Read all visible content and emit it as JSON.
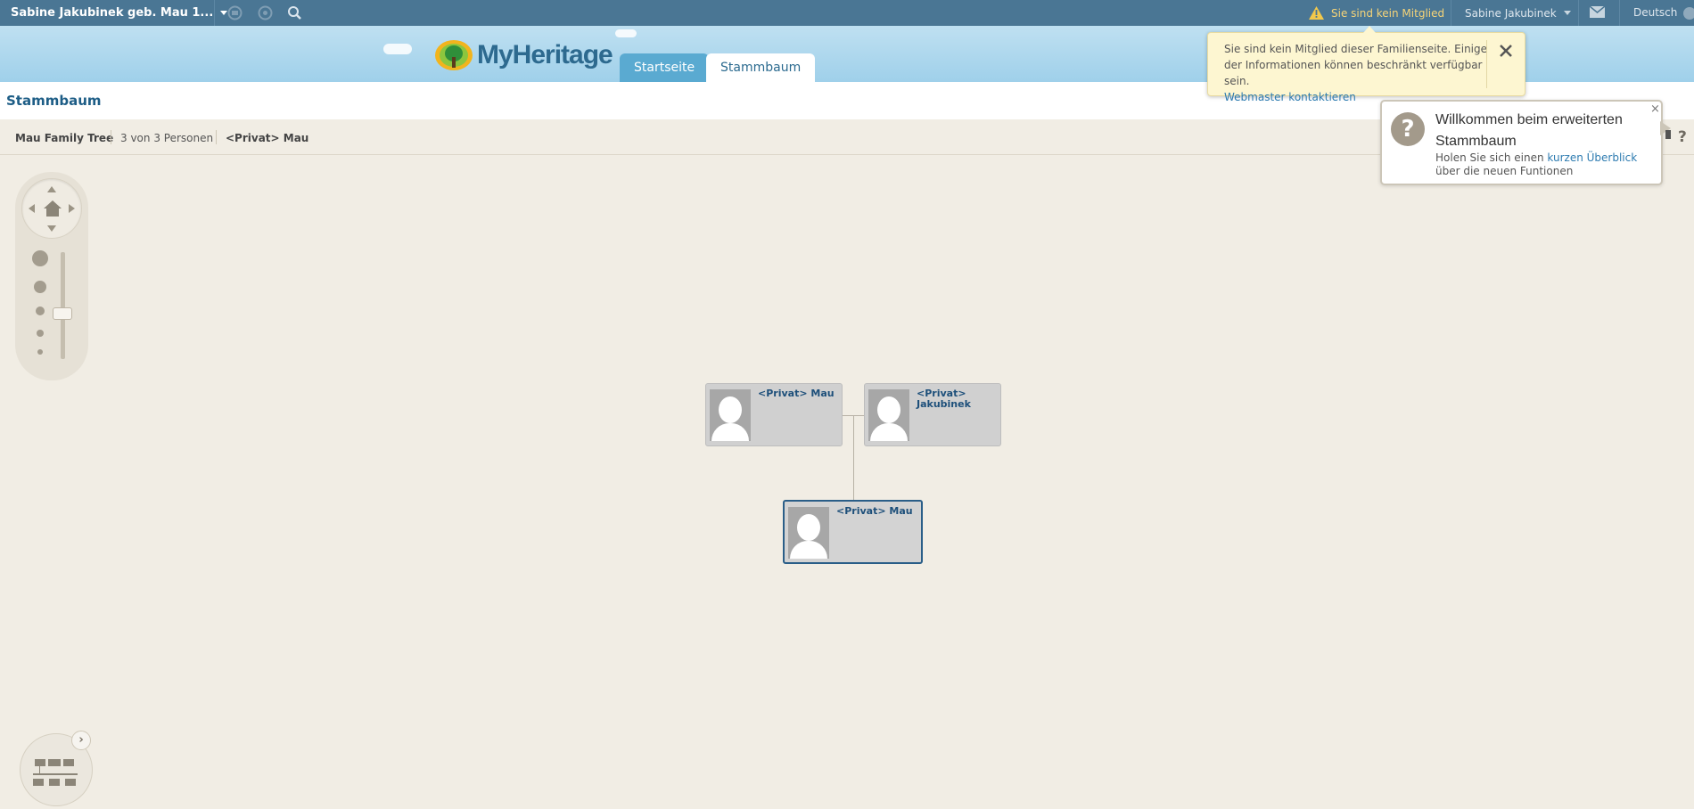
{
  "topbar": {
    "site_name": "Sabine Jakubinek geb. Mau 1...",
    "warning": "Sie sind kein Mitglied",
    "user_name": "Sabine Jakubinek",
    "language": "Deutsch",
    "icons": [
      "caret-down-icon",
      "history-back-icon",
      "history-forward-icon",
      "search-icon",
      "warning-icon",
      "mail-icon",
      "globe-icon"
    ]
  },
  "header": {
    "logo_text": "MyHeritage",
    "tabs": [
      {
        "label": "Startseite"
      },
      {
        "label": "Stammbaum"
      }
    ]
  },
  "page": {
    "title": "Stammbaum"
  },
  "breadcrumb": {
    "tree_name": "Mau Family Tree",
    "count": "3 von 3 Personen",
    "person": "<Privat> Mau"
  },
  "notification": {
    "text": "Sie sind kein Mitglied dieser Familienseite. Einige der Informationen können beschränkt verfügbar sein.",
    "link": "Webmaster kontaktieren"
  },
  "welcome": {
    "title": "Willkommen beim erweiterten Stammbaum",
    "body_prefix": "Holen Sie sich einen",
    "link": "kurzen Überblick",
    "body_suffix": "über die neuen Funtionen",
    "close": "×"
  },
  "tree": {
    "persons": [
      {
        "name": "<Privat> Mau",
        "selected": false
      },
      {
        "name": "<Privat> Jakubinek",
        "selected": false
      },
      {
        "name": "<Privat> Mau",
        "selected": true
      }
    ]
  },
  "help": {
    "label": "?"
  },
  "overview": {
    "expand": "›"
  },
  "colors": {
    "topbar": "#4a7694",
    "accent": "#2d7bb0",
    "canvas": "#f1ede4",
    "selected_border": "#2a5e88"
  }
}
